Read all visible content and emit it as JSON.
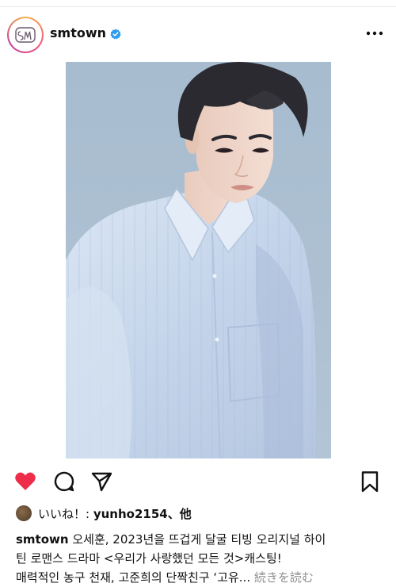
{
  "post": {
    "username": "smtown",
    "verified": true,
    "likes_label": "いいね！: ",
    "likes_user": "yunho2154",
    "likes_suffix": "、他",
    "caption_line1": "오세훈, 2023년을 뜨겁게 달굴 티빙 오리지널 하이",
    "caption_line2": "틴 로맨스 드라마 <우리가 사랑했던 모든 것>캐스팅!",
    "caption_line3": "매력적인 농구 천재, 고준희의 단짝친구 ‘고유...",
    "more_label": "続きを読む"
  },
  "colors": {
    "like_red": "#ed2d49",
    "verified_blue": "#2d9cf0",
    "photo_bg": "#aec1d3"
  },
  "icons": [
    "heart-icon",
    "comment-icon",
    "share-icon",
    "bookmark-icon",
    "more-icon",
    "verified-icon"
  ]
}
